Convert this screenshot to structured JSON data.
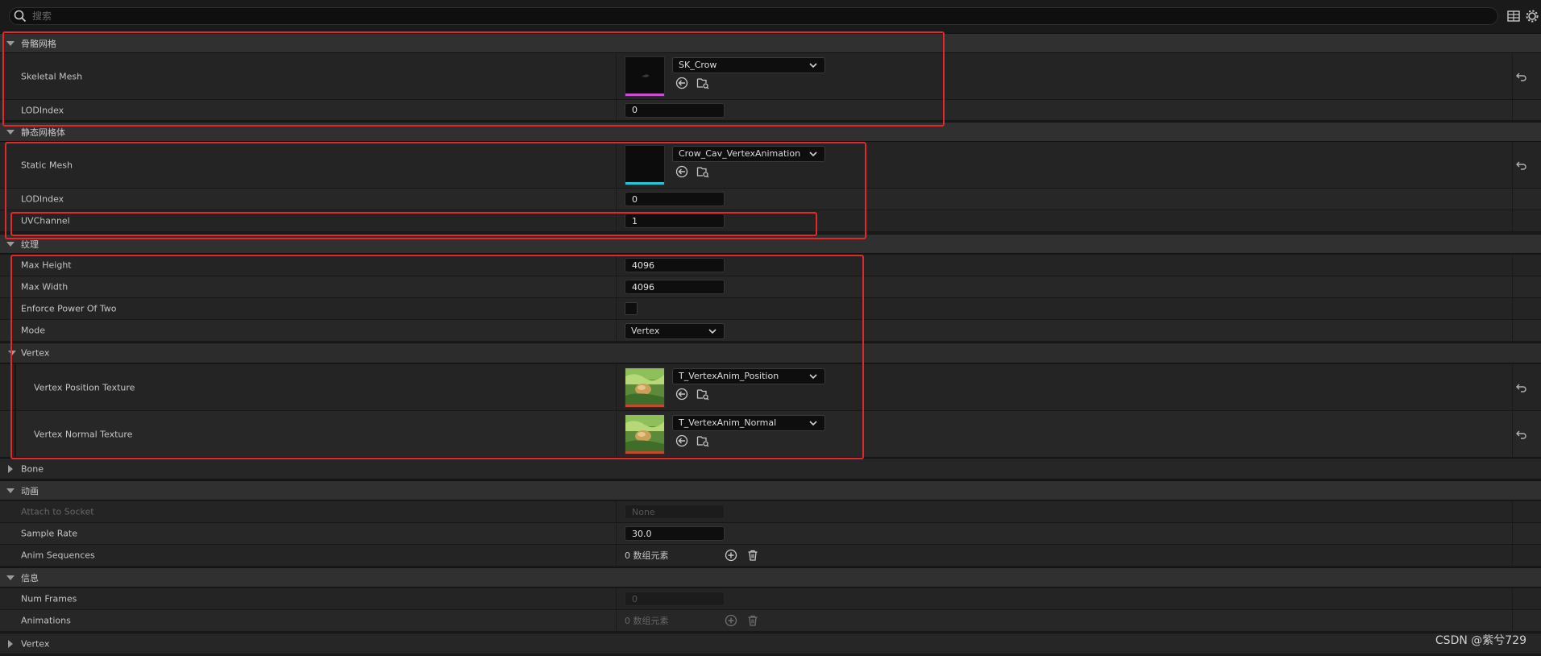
{
  "search": {
    "placeholder": "搜索"
  },
  "sections": {
    "skeletal": {
      "title": "骨骼网格",
      "skeletal_mesh": {
        "label": "Skeletal Mesh",
        "asset": "SK_Crow"
      },
      "lod_index": {
        "label": "LODIndex",
        "value": "0"
      }
    },
    "static": {
      "title": "静态网格体",
      "static_mesh": {
        "label": "Static Mesh",
        "asset": "Crow_Cav_VertexAnimation"
      },
      "lod_index": {
        "label": "LODIndex",
        "value": "0"
      },
      "uv_channel": {
        "label": "UVChannel",
        "value": "1"
      }
    },
    "texture": {
      "title": "纹理",
      "max_height": {
        "label": "Max Height",
        "value": "4096"
      },
      "max_width": {
        "label": "Max Width",
        "value": "4096"
      },
      "enforce_pow2": {
        "label": "Enforce Power Of Two",
        "checked": false
      },
      "mode": {
        "label": "Mode",
        "value": "Vertex"
      },
      "vertex_group": {
        "title": "Vertex",
        "position_texture": {
          "label": "Vertex Position Texture",
          "asset": "T_VertexAnim_Position"
        },
        "normal_texture": {
          "label": "Vertex Normal Texture",
          "asset": "T_VertexAnim_Normal"
        }
      },
      "bone_group": {
        "title": "Bone"
      }
    },
    "animation": {
      "title": "动画",
      "attach_socket": {
        "label": "Attach to Socket",
        "value": "None"
      },
      "sample_rate": {
        "label": "Sample Rate",
        "value": "30.0"
      },
      "anim_sequences": {
        "label": "Anim Sequences",
        "value": "0 数组元素"
      }
    },
    "info": {
      "title": "信息",
      "num_frames": {
        "label": "Num Frames",
        "value": "0"
      },
      "animations": {
        "label": "Animations",
        "value": "0 数组元素"
      },
      "vertex_group": {
        "title": "Vertex"
      }
    }
  },
  "watermark": "CSDN @紫兮729",
  "colors": {
    "highlight_box": "#e0282d",
    "skeletal_thumb_line": "#c84fd2",
    "static_thumb_line": "#25c6d6"
  }
}
